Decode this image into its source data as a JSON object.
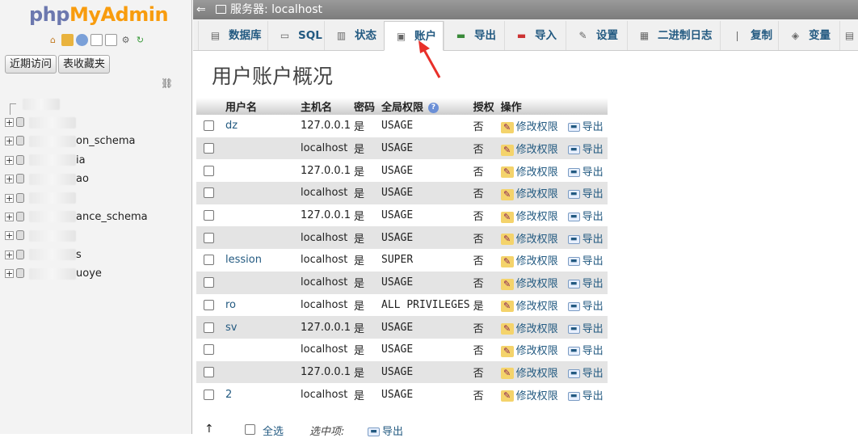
{
  "nav": {
    "logo_php": "php",
    "logo_myadmin": "MyAdmin",
    "tab_recent": "近期访问",
    "tab_favorites": "表收藏夹",
    "databases": [
      {
        "label": ""
      },
      {
        "label": "on_schema"
      },
      {
        "label": "ia"
      },
      {
        "label": "ao"
      },
      {
        "label": ""
      },
      {
        "label": "ance_schema"
      },
      {
        "label": ""
      },
      {
        "label": "s"
      },
      {
        "label": "uoye"
      }
    ]
  },
  "topbar": {
    "server_label": "服务器: ",
    "server_name": "localhost"
  },
  "tabs": [
    {
      "label": "数据库",
      "icon": "database-icon"
    },
    {
      "label": "SQL",
      "icon": "sql-icon"
    },
    {
      "label": "状态",
      "icon": "status-icon"
    },
    {
      "label": "账户",
      "icon": "accounts-icon"
    },
    {
      "label": "导出",
      "icon": "export-icon"
    },
    {
      "label": "导入",
      "icon": "import-icon"
    },
    {
      "label": "设置",
      "icon": "settings-icon"
    },
    {
      "label": "二进制日志",
      "icon": "binlog-icon"
    },
    {
      "label": "复制",
      "icon": "replication-icon"
    },
    {
      "label": "变量",
      "icon": "variables-icon"
    }
  ],
  "main": {
    "title": "用户账户概况",
    "columns": [
      "用户名",
      "主机名",
      "密码",
      "全局权限",
      "授权",
      "操作"
    ],
    "edit_label": "修改权限",
    "export_label": "导出",
    "rows": [
      {
        "user": "dz",
        "host": "127.0.0.1",
        "password": "是",
        "privileges": "USAGE",
        "grant": "否"
      },
      {
        "user": "",
        "host": "localhost",
        "password": "是",
        "privileges": "USAGE",
        "grant": "否"
      },
      {
        "user": "",
        "host": "127.0.0.1",
        "password": "是",
        "privileges": "USAGE",
        "grant": "否"
      },
      {
        "user": "",
        "host": "localhost",
        "password": "是",
        "privileges": "USAGE",
        "grant": "否"
      },
      {
        "user": "",
        "host": "127.0.0.1",
        "password": "是",
        "privileges": "USAGE",
        "grant": "否"
      },
      {
        "user": "",
        "host": "localhost",
        "password": "是",
        "privileges": "USAGE",
        "grant": "否"
      },
      {
        "user": "lession",
        "host": "localhost",
        "password": "是",
        "privileges": "SUPER",
        "grant": "否"
      },
      {
        "user": "",
        "host": "localhost",
        "password": "是",
        "privileges": "USAGE",
        "grant": "否"
      },
      {
        "user": "ro",
        "host": "localhost",
        "password": "是",
        "privileges": "ALL PRIVILEGES",
        "grant": "是"
      },
      {
        "user": "sv",
        "host": "127.0.0.1",
        "password": "是",
        "privileges": "USAGE",
        "grant": "否"
      },
      {
        "user": "",
        "host": "localhost",
        "password": "是",
        "privileges": "USAGE",
        "grant": "否"
      },
      {
        "user": "",
        "host": "127.0.0.1",
        "password": "是",
        "privileges": "USAGE",
        "grant": "否"
      },
      {
        "user": "2",
        "host": "localhost",
        "password": "是",
        "privileges": "USAGE",
        "grant": "否"
      }
    ]
  },
  "footer": {
    "select_all": "全选",
    "with_selected": "选中项:",
    "export": "导出"
  },
  "colors": {
    "link": "#235a81",
    "annotation": "#e8302a"
  }
}
